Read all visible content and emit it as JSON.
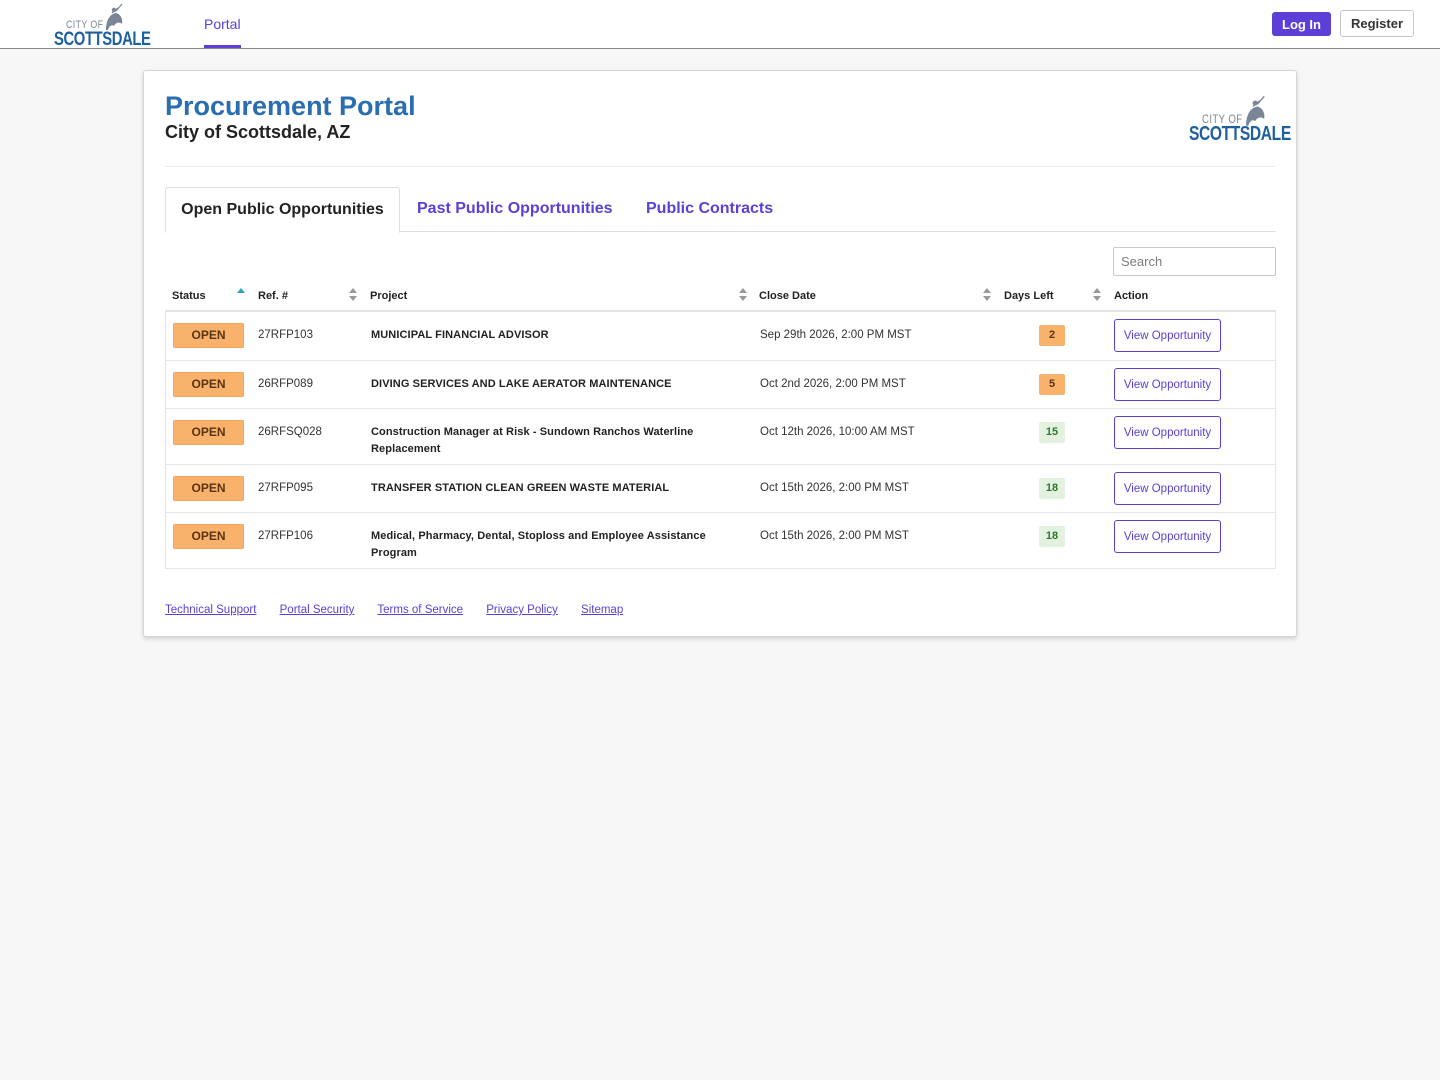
{
  "nav": {
    "logo_city": "CITY OF",
    "logo_name": "SCOTTSDALE",
    "portal_tab": "Portal",
    "login_label": "Log In",
    "register_label": "Register"
  },
  "header": {
    "title": "Procurement Portal",
    "subtitle": "City of Scottsdale, AZ"
  },
  "tabs": [
    {
      "label": "Open Public Opportunities",
      "active": true
    },
    {
      "label": "Past Public Opportunities",
      "active": false
    },
    {
      "label": "Public Contracts",
      "active": false
    }
  ],
  "search": {
    "placeholder": "Search"
  },
  "table": {
    "columns": [
      "Status",
      "Ref. #",
      "Project",
      "Close Date",
      "Days Left",
      "Action"
    ],
    "sorted_column": "Status",
    "rows": [
      {
        "status": "OPEN",
        "ref": "27RFP103",
        "project": "MUNICIPAL FINANCIAL ADVISOR",
        "close_date": "Sep 29th 2026, 2:00 PM MST",
        "days_left": "2",
        "days_state": "warn",
        "action": "View Opportunity"
      },
      {
        "status": "OPEN",
        "ref": "26RFP089",
        "project": "DIVING SERVICES AND LAKE AERATOR MAINTENANCE",
        "close_date": "Oct 2nd 2026, 2:00 PM MST",
        "days_left": "5",
        "days_state": "warn",
        "action": "View Opportunity"
      },
      {
        "status": "OPEN",
        "ref": "26RFSQ028",
        "project": "Construction Manager at Risk - Sundown Ranchos Waterline Replacement",
        "close_date": "Oct 12th 2026, 10:00 AM MST",
        "days_left": "15",
        "days_state": "ok",
        "action": "View Opportunity"
      },
      {
        "status": "OPEN",
        "ref": "27RFP095",
        "project": "TRANSFER STATION CLEAN GREEN WASTE MATERIAL",
        "close_date": "Oct 15th 2026, 2:00 PM MST",
        "days_left": "18",
        "days_state": "ok",
        "action": "View Opportunity"
      },
      {
        "status": "OPEN",
        "ref": "27RFP106",
        "project": "Medical, Pharmacy, Dental, Stoploss and Employee Assistance Program",
        "close_date": "Oct 15th 2026, 2:00 PM MST",
        "days_left": "18",
        "days_state": "ok",
        "action": "View Opportunity"
      }
    ]
  },
  "footer": {
    "links": [
      "Technical Support",
      "Portal Security",
      "Terms of Service",
      "Privacy Policy",
      "Sitemap"
    ]
  },
  "colors": {
    "accent": "#5b3fd6",
    "title_blue": "#2a6db0",
    "open_badge": "#f9b26c",
    "days_ok_bg": "#e4f1df"
  }
}
